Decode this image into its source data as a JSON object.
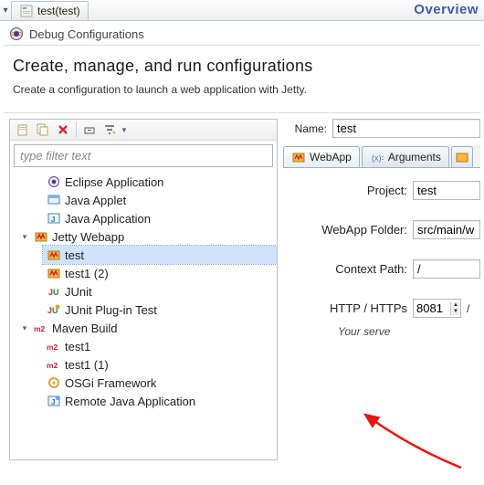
{
  "topTab": "test(test)",
  "topRight": "Overview",
  "dialogTitle": "Debug Configurations",
  "bannerTitle": "Create, manage, and run configurations",
  "bannerSub": "Create a configuration to launch a web application with Jetty.",
  "filterPlaceholder": "type filter text",
  "tree": {
    "eclipseApp": "Eclipse Application",
    "javaApplet": "Java Applet",
    "javaApp": "Java Application",
    "jettyWebapp": "Jetty Webapp",
    "jettyTest": "test",
    "jettyTest1": "test1 (2)",
    "junit": "JUnit",
    "junitPlugin": "JUnit Plug-in Test",
    "mavenBuild": "Maven Build",
    "mvTest1": "test1",
    "mvTest1b": "test1 (1)",
    "osgi": "OSGi Framework",
    "remoteJava": "Remote Java Application"
  },
  "name": {
    "label": "Name:",
    "value": "test"
  },
  "tabs": {
    "webapp": "WebApp",
    "arguments": "Arguments"
  },
  "form": {
    "projectLabel": "Project:",
    "projectValue": "test",
    "webappFolderLabel": "WebApp Folder:",
    "webappFolderValue": "src/main/w",
    "contextPathLabel": "Context Path:",
    "contextPathValue": "/",
    "httpLabel": "HTTP / HTTPs",
    "httpValue": "8081",
    "slash": "/",
    "note": "Your serve"
  }
}
